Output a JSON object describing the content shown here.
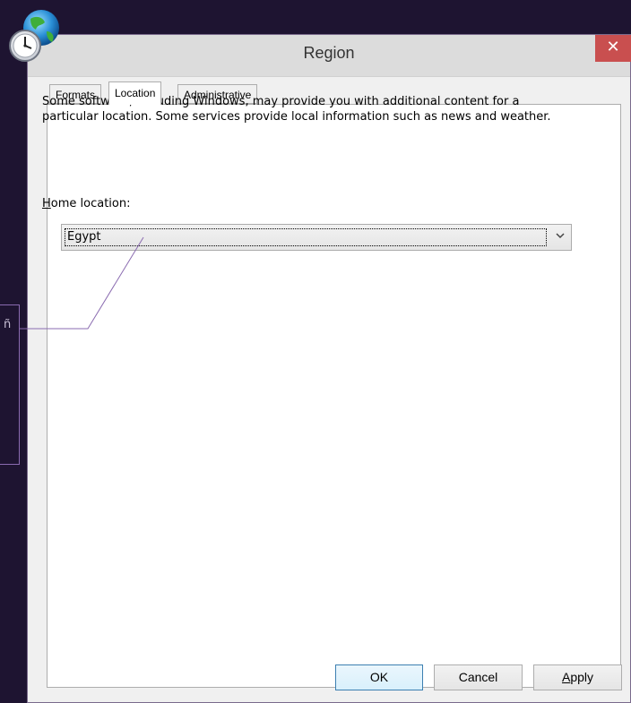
{
  "window": {
    "title": "Region",
    "close_glyph": "✕"
  },
  "tabs": [
    {
      "label": "Formats",
      "active": false
    },
    {
      "label": "Location",
      "active": true
    },
    {
      "label": "Administrative",
      "active": false
    }
  ],
  "location": {
    "description": "Some software, including Windows, may provide you with additional content for a particular location. Some services provide local information such as news and weather.",
    "home_label_mnemonic": "H",
    "home_label_rest": "ome location:",
    "home_value": "Egypt"
  },
  "buttons": {
    "ok": "OK",
    "cancel": "Cancel",
    "apply_mnemonic": "A",
    "apply_rest": "pply"
  },
  "background": {
    "callout_glyph": "ñ"
  },
  "icons": {
    "app": "globe-clock-icon",
    "close": "close-icon",
    "dropdown": "chevron-down-icon"
  },
  "colors": {
    "desktop": "#1e1431",
    "close_button": "#c94f4f",
    "callout_line": "#8a6bb0"
  }
}
